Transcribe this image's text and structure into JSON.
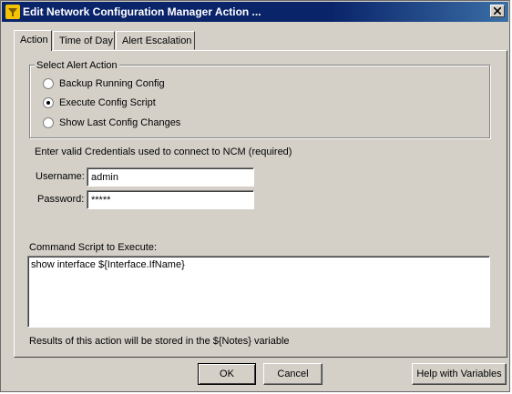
{
  "window": {
    "title": "Edit Network Configuration Manager Action ...",
    "icon": "funnel-icon",
    "close_icon": "close-icon"
  },
  "tabs": [
    {
      "label": "Action",
      "active": true
    },
    {
      "label": "Time of Day",
      "active": false
    },
    {
      "label": "Alert Escalation",
      "active": false
    }
  ],
  "alert_action": {
    "legend": "Select Alert Action",
    "options": [
      {
        "label": "Backup Running Config",
        "checked": false
      },
      {
        "label": "Execute Config Script",
        "checked": true
      },
      {
        "label": "Show Last Config Changes",
        "checked": false
      }
    ]
  },
  "credentials": {
    "note": "Enter valid Credentials used to connect to NCM (required)",
    "username_label": "Username:",
    "username_value": "admin",
    "password_label": "Password:",
    "password_value": "*****"
  },
  "script": {
    "label": "Command Script to Execute:",
    "value": "show interface ${Interface.IfName}",
    "results_note": "Results of this action will be stored in the ${Notes} variable"
  },
  "buttons": {
    "ok": "OK",
    "cancel": "Cancel",
    "help": "Help with Variables"
  }
}
